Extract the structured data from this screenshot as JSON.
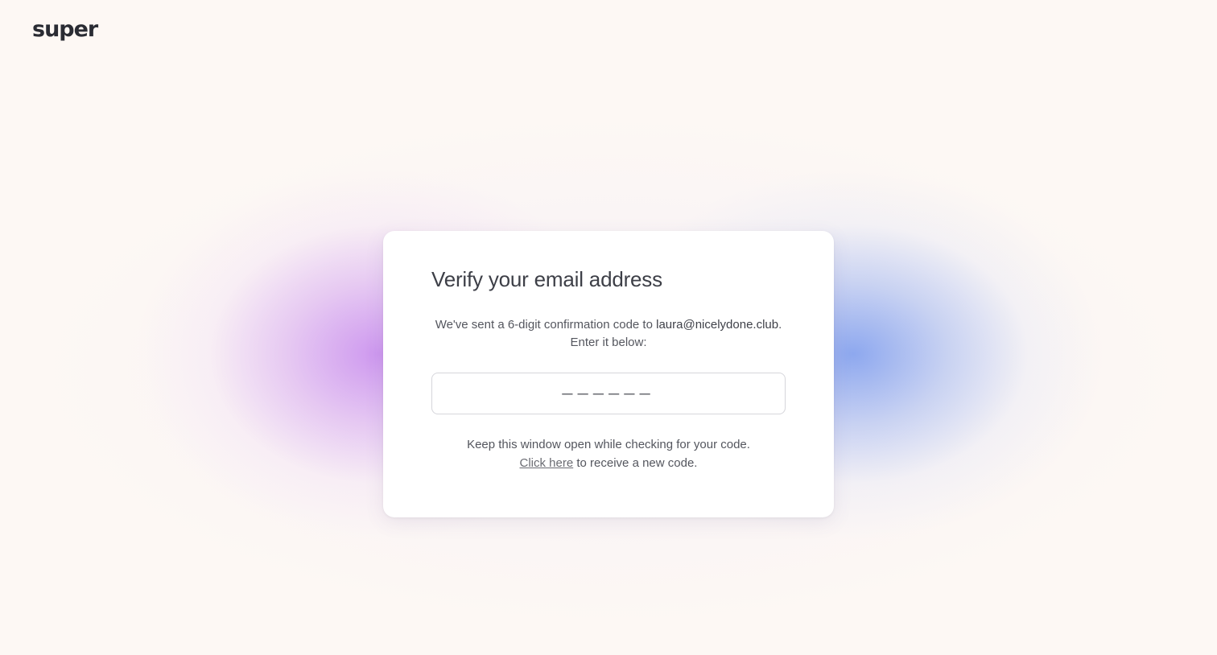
{
  "brand": {
    "logo_text": "super",
    "logo_icon": "eye-ring-icon"
  },
  "card": {
    "title": "Verify your email address",
    "description_prefix": "We've sent a 6-digit confirmation code to ",
    "email": "laura@nicelydone.club",
    "description_suffix": ".",
    "description_line2": "Enter it below:",
    "code_input": {
      "value": "",
      "placeholder": "––––––"
    },
    "hint_line1": "Keep this window open while checking for your code.",
    "resend_link_label": "Click here",
    "resend_suffix": " to receive a new code."
  },
  "colors": {
    "background": "#fdf8f4",
    "glow_left": "#c88cee",
    "glow_right": "#82a0ee",
    "text_primary": "#3d3f47",
    "text_secondary": "#54565e"
  }
}
